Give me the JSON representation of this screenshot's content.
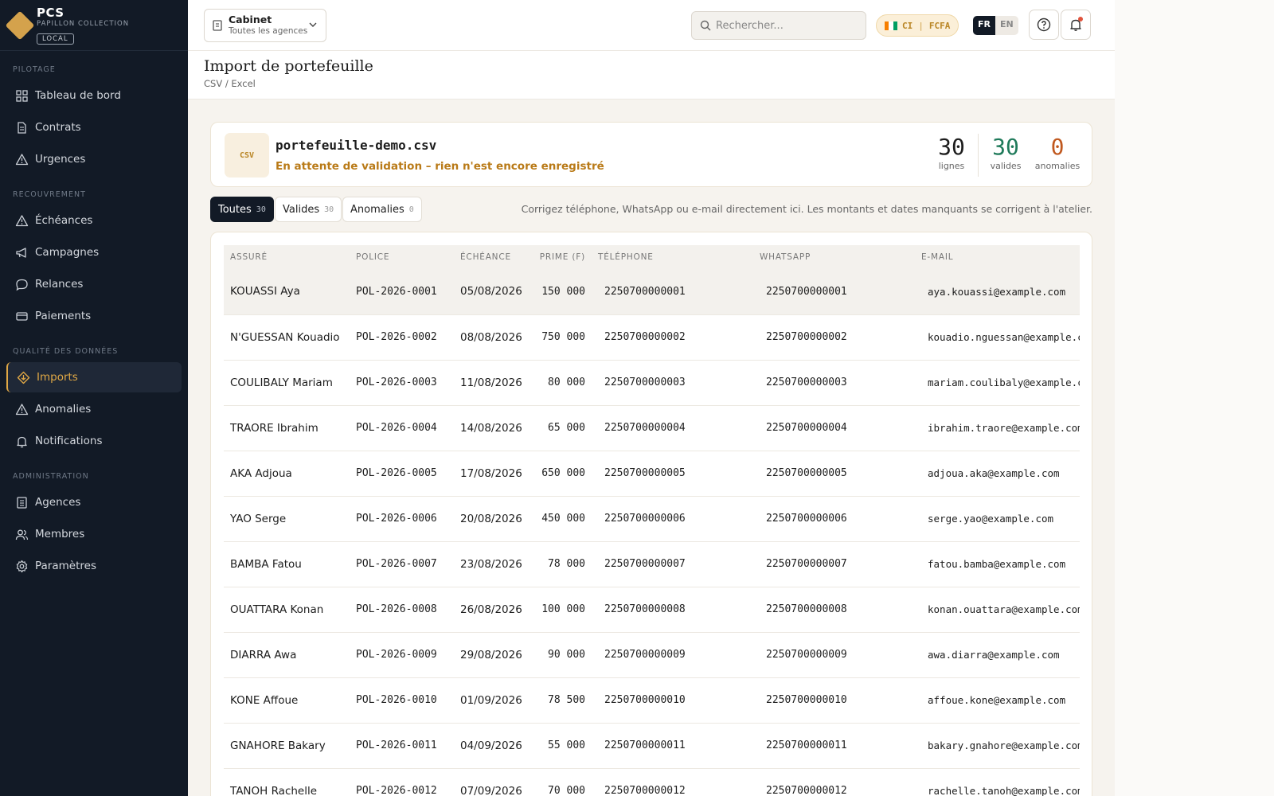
{
  "app": {
    "name": "PCS",
    "subtitle": "PAPILLON COLLECTION",
    "env_badge": "LOCAL"
  },
  "sidebar": {
    "sections": [
      {
        "title": "PILOTAGE",
        "items": [
          {
            "label": "Tableau de bord",
            "icon": "dashboard-icon"
          },
          {
            "label": "Contrats",
            "icon": "document-icon"
          },
          {
            "label": "Urgences",
            "icon": "warning-icon"
          }
        ]
      },
      {
        "title": "RECOUVREMENT",
        "items": [
          {
            "label": "Échéances",
            "icon": "warning-icon"
          },
          {
            "label": "Campagnes",
            "icon": "megaphone-icon"
          },
          {
            "label": "Relances",
            "icon": "chat-icon"
          },
          {
            "label": "Paiements",
            "icon": "card-icon"
          }
        ]
      },
      {
        "title": "QUALITÉ DES DONNÉES",
        "items": [
          {
            "label": "Imports",
            "icon": "import-icon",
            "active": true
          },
          {
            "label": "Anomalies",
            "icon": "warning-icon"
          },
          {
            "label": "Notifications",
            "icon": "bell-icon"
          }
        ]
      },
      {
        "title": "ADMINISTRATION",
        "items": [
          {
            "label": "Agences",
            "icon": "building-icon"
          },
          {
            "label": "Membres",
            "icon": "users-icon"
          },
          {
            "label": "Paramètres",
            "icon": "gear-icon"
          }
        ]
      }
    ]
  },
  "topbar": {
    "cabinet_title": "Cabinet",
    "cabinet_sub": "Toutes les agences",
    "search_placeholder": "Rechercher...",
    "country": "CI",
    "currency": "FCFA",
    "lang_active": "FR",
    "lang_other": "EN"
  },
  "page": {
    "title": "Import de portefeuille",
    "subtitle": "CSV / Excel"
  },
  "file": {
    "icon_label": "CSV",
    "name": "portefeuille-demo.csv",
    "status": "En attente de validation – rien n'est encore enregistré",
    "stats": [
      {
        "value": "30",
        "label": "lignes",
        "color": "#1d1d1d"
      },
      {
        "value": "30",
        "label": "valides",
        "color": "#1f7a5a"
      },
      {
        "value": "0",
        "label": "anomalies",
        "color": "#c0581e"
      }
    ]
  },
  "filters": [
    {
      "label": "Toutes",
      "count": "30",
      "active": true
    },
    {
      "label": "Valides",
      "count": "30",
      "active": false
    },
    {
      "label": "Anomalies",
      "count": "0",
      "active": false
    }
  ],
  "hint": "Corrigez téléphone, WhatsApp ou e-mail directement ici. Les montants et dates manquants se corrigent à l'atelier.",
  "table": {
    "headers": [
      "ASSURÉ",
      "POLICE",
      "ÉCHÉANCE",
      "PRIME (F)",
      "TÉLÉPHONE",
      "WHATSAPP",
      "E-MAIL"
    ],
    "rows": [
      [
        "KOUASSI Aya",
        "POL-2026-0001",
        "05/08/2026",
        "150 000",
        "2250700000001",
        "2250700000001",
        "aya.kouassi@example.com"
      ],
      [
        "N'GUESSAN Kouadio",
        "POL-2026-0002",
        "08/08/2026",
        "750 000",
        "2250700000002",
        "2250700000002",
        "kouadio.nguessan@example.com"
      ],
      [
        "COULIBALY Mariam",
        "POL-2026-0003",
        "11/08/2026",
        "80 000",
        "2250700000003",
        "2250700000003",
        "mariam.coulibaly@example.com"
      ],
      [
        "TRAORE Ibrahim",
        "POL-2026-0004",
        "14/08/2026",
        "65 000",
        "2250700000004",
        "2250700000004",
        "ibrahim.traore@example.com"
      ],
      [
        "AKA Adjoua",
        "POL-2026-0005",
        "17/08/2026",
        "650 000",
        "2250700000005",
        "2250700000005",
        "adjoua.aka@example.com"
      ],
      [
        "YAO Serge",
        "POL-2026-0006",
        "20/08/2026",
        "450 000",
        "2250700000006",
        "2250700000006",
        "serge.yao@example.com"
      ],
      [
        "BAMBA Fatou",
        "POL-2026-0007",
        "23/08/2026",
        "78 000",
        "2250700000007",
        "2250700000007",
        "fatou.bamba@example.com"
      ],
      [
        "OUATTARA Konan",
        "POL-2026-0008",
        "26/08/2026",
        "100 000",
        "2250700000008",
        "2250700000008",
        "konan.ouattara@example.com"
      ],
      [
        "DIARRA Awa",
        "POL-2026-0009",
        "29/08/2026",
        "90 000",
        "2250700000009",
        "2250700000009",
        "awa.diarra@example.com"
      ],
      [
        "KONE Affoue",
        "POL-2026-0010",
        "01/09/2026",
        "78 500",
        "2250700000010",
        "2250700000010",
        "affoue.kone@example.com"
      ],
      [
        "GNAHORE Bakary",
        "POL-2026-0011",
        "04/09/2026",
        "55 000",
        "2250700000011",
        "2250700000011",
        "bakary.gnahore@example.com"
      ],
      [
        "TANOH Rachelle",
        "POL-2026-0012",
        "07/09/2026",
        "70 000",
        "2250700000012",
        "2250700000012",
        "rachelle.tanoh@example.com"
      ]
    ]
  }
}
